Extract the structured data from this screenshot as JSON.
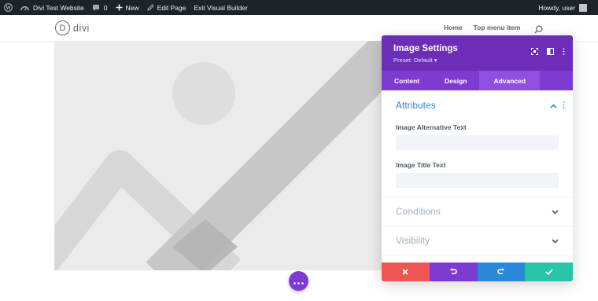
{
  "admin_bar": {
    "site_name": "Divi Test Website",
    "comments_count": "0",
    "new_label": "New",
    "edit_label": "Edit Page",
    "exit_label": "Exit Visual Builder",
    "greeting": "Howdy, user"
  },
  "site": {
    "logo_letter": "D",
    "logo_text": "divi",
    "nav": [
      "Home",
      "Top menu item"
    ]
  },
  "panel": {
    "title": "Image Settings",
    "preset": "Preset: Default ▾",
    "tabs": [
      "Content",
      "Design",
      "Advanced"
    ],
    "active_tab": "Advanced",
    "attributes": {
      "title": "Attributes",
      "fields": [
        {
          "label": "Image Alternative Text",
          "value": "",
          "placeholder": ""
        },
        {
          "label": "Image Title Text",
          "value": "",
          "placeholder": ""
        }
      ]
    },
    "collapsed_sections": [
      "Conditions",
      "Visibility"
    ]
  },
  "colors": {
    "admin_bar": "#1d2327",
    "panel_header": "#6c2eb9",
    "tabs_bg": "#7e3bd0",
    "accent_blue": "#2b87da",
    "cancel": "#ef5555",
    "undo": "#7e3bd0",
    "redo": "#2b87da",
    "save": "#29c4a9"
  },
  "icons": {
    "admin_bar": [
      "wordpress-logo-icon",
      "dashboard-icon",
      "comment-icon",
      "plus-icon",
      "pencil-icon"
    ],
    "panel_header": [
      "focus-icon",
      "split-view-icon",
      "more-vertical-icon"
    ],
    "footer": [
      "close-icon",
      "undo-icon",
      "redo-icon",
      "check-icon"
    ]
  }
}
